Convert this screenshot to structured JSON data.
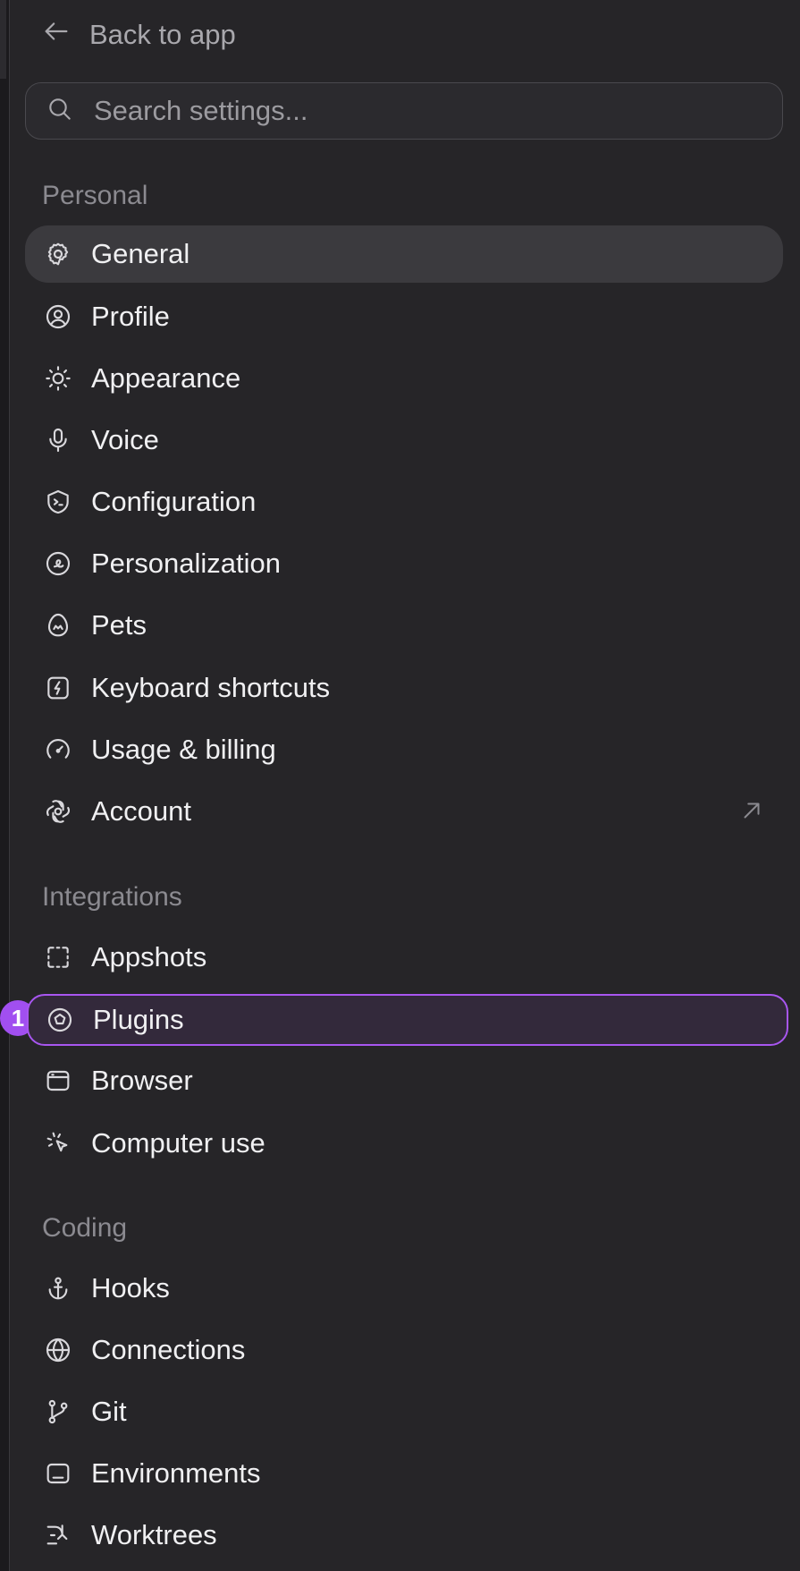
{
  "back": {
    "label": "Back to app"
  },
  "search": {
    "placeholder": "Search settings..."
  },
  "sections": {
    "personal": {
      "title": "Personal",
      "items": [
        {
          "label": "General",
          "icon": "gear-icon",
          "active": true
        },
        {
          "label": "Profile",
          "icon": "user-circle-icon"
        },
        {
          "label": "Appearance",
          "icon": "sun-icon"
        },
        {
          "label": "Voice",
          "icon": "microphone-icon"
        },
        {
          "label": "Configuration",
          "icon": "terminal-shield-icon"
        },
        {
          "label": "Personalization",
          "icon": "personalization-icon"
        },
        {
          "label": "Pets",
          "icon": "pet-egg-icon"
        },
        {
          "label": "Keyboard shortcuts",
          "icon": "lightning-square-icon"
        },
        {
          "label": "Usage & billing",
          "icon": "gauge-icon"
        },
        {
          "label": "Account",
          "icon": "openai-logo-icon",
          "external_icon": "arrow-up-right-icon"
        }
      ]
    },
    "integrations": {
      "title": "Integrations",
      "items": [
        {
          "label": "Appshots",
          "icon": "capture-frame-icon"
        },
        {
          "label": "Plugins",
          "icon": "plugin-icon",
          "highlighted": true,
          "badge": "1"
        },
        {
          "label": "Browser",
          "icon": "browser-window-icon"
        },
        {
          "label": "Computer use",
          "icon": "cursor-click-icon"
        }
      ]
    },
    "coding": {
      "title": "Coding",
      "items": [
        {
          "label": "Hooks",
          "icon": "anchor-icon"
        },
        {
          "label": "Connections",
          "icon": "globe-icon"
        },
        {
          "label": "Git",
          "icon": "git-branch-icon"
        },
        {
          "label": "Environments",
          "icon": "monitor-icon"
        },
        {
          "label": "Worktrees",
          "icon": "worktree-icon"
        }
      ]
    }
  },
  "colors": {
    "background": "#262528",
    "active_bg": "#3b3a3e",
    "highlight_border": "#a856f0",
    "badge_bg": "#a14ff0",
    "section_text": "#8b8a90"
  }
}
